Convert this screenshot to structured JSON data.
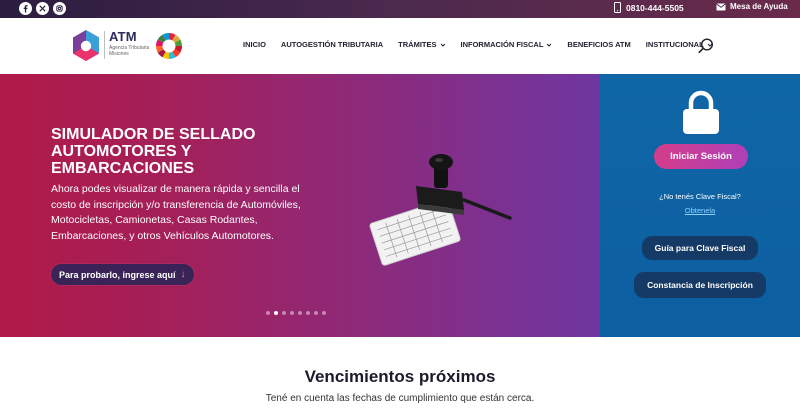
{
  "topbar": {
    "social": [
      "facebook-icon",
      "x-icon",
      "instagram-icon"
    ],
    "phone": "0810-444-5505",
    "help": "Mesa de Ayuda"
  },
  "header": {
    "logo_title": "ATM",
    "logo_subtitle": "Agencia Tributaria Misiones",
    "nav": [
      {
        "label": "INICIO",
        "dropdown": false
      },
      {
        "label": "AUTOGESTIÓN TRIBUTARIA",
        "dropdown": false
      },
      {
        "label": "TRÁMITES",
        "dropdown": true
      },
      {
        "label": "INFORMACIÓN FISCAL",
        "dropdown": true
      },
      {
        "label": "BENEFICIOS ATM",
        "dropdown": false
      },
      {
        "label": "INSTITUCIONAL",
        "dropdown": true
      }
    ]
  },
  "hero": {
    "title": "SIMULADOR DE SELLADO AUTOMOTORES Y EMBARCACIONES",
    "description": "Ahora podes visualizar de manera rápida y sencilla el costo de inscripción y/o transferencia de Automóviles, Motocicletas, Camionetas, Casas Rodantes, Embarcaciones, y otros Vehículos Automotores.",
    "cta": "Para probarlo, ingrese aquí",
    "cta_arrow": "↓",
    "slides": 8,
    "active_slide": 1
  },
  "login": {
    "button": "Iniciar Sesión",
    "question": "¿No tenés Clave Fiscal?",
    "link": "Obtenela",
    "guide": "Guía para Clave Fiscal",
    "constancia": "Constancia de Inscripción"
  },
  "section": {
    "title": "Vencimientos próximos",
    "subtitle": "Tené en cuenta las fechas de cumplimiento que están cerca."
  },
  "colors": {
    "topbar": "#3b2446",
    "hero_start": "#b01a48",
    "hero_end": "#6f36a1",
    "panel": "#0f66a6",
    "login_button": "#c93d9e",
    "dark_button": "#153a66"
  }
}
